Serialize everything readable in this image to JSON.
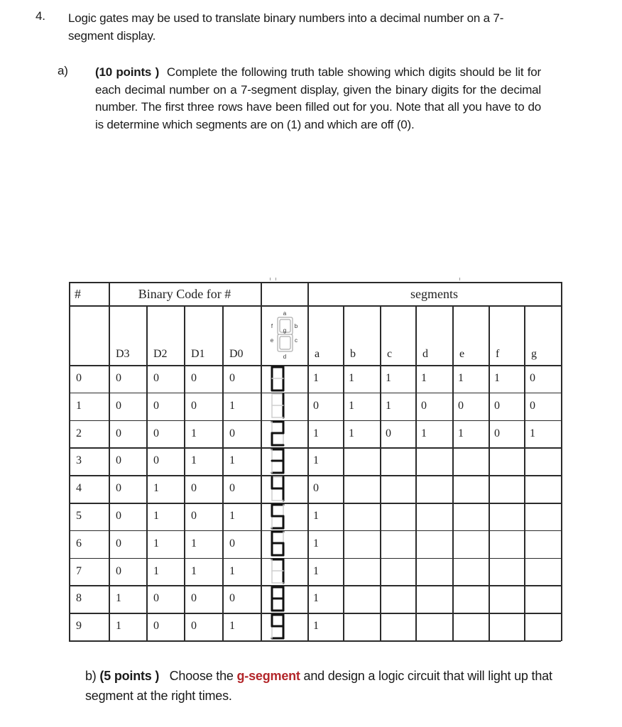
{
  "question": {
    "number": "4.",
    "text": "Logic gates may be used to translate binary numbers into a decimal number on a 7-segment display."
  },
  "part_a": {
    "label": "a)",
    "points": "(10 points )",
    "text": "Complete the following truth table showing which digits should be lit for each decimal number on a 7-segment display, given the binary digits for the decimal number. The first three rows have been filled out for you. Note that all you have to do is determine which segments are on (1) and which are off (0)."
  },
  "table": {
    "header_hash": "#",
    "header_binary": "Binary Code for #",
    "header_segments": "segments",
    "bit_headers": [
      "D3",
      "D2",
      "D1",
      "D0"
    ],
    "segment_headers": [
      "a",
      "b",
      "c",
      "d",
      "e",
      "f",
      "g"
    ],
    "diagram_labels": {
      "a": "a",
      "b": "b",
      "c": "c",
      "d": "d",
      "e": "e",
      "f": "f",
      "g": "g"
    },
    "rows": [
      {
        "num": "0",
        "bits": [
          "0",
          "0",
          "0",
          "0"
        ],
        "lit": "abcdef",
        "segs": [
          "1",
          "1",
          "1",
          "1",
          "1",
          "1",
          "0"
        ]
      },
      {
        "num": "1",
        "bits": [
          "0",
          "0",
          "0",
          "1"
        ],
        "lit": "bc",
        "segs": [
          "0",
          "1",
          "1",
          "0",
          "0",
          "0",
          "0"
        ]
      },
      {
        "num": "2",
        "bits": [
          "0",
          "0",
          "1",
          "0"
        ],
        "lit": "abdeg",
        "segs": [
          "1",
          "1",
          "0",
          "1",
          "1",
          "0",
          "1"
        ]
      },
      {
        "num": "3",
        "bits": [
          "0",
          "0",
          "1",
          "1"
        ],
        "lit": "abcdg",
        "segs": [
          "1",
          "",
          "",
          "",
          "",
          "",
          ""
        ]
      },
      {
        "num": "4",
        "bits": [
          "0",
          "1",
          "0",
          "0"
        ],
        "lit": "bcfg",
        "segs": [
          "0",
          "",
          "",
          "",
          "",
          "",
          ""
        ]
      },
      {
        "num": "5",
        "bits": [
          "0",
          "1",
          "0",
          "1"
        ],
        "lit": "acdfg",
        "segs": [
          "1",
          "",
          "",
          "",
          "",
          "",
          ""
        ]
      },
      {
        "num": "6",
        "bits": [
          "0",
          "1",
          "1",
          "0"
        ],
        "lit": "acdefg",
        "segs": [
          "1",
          "",
          "",
          "",
          "",
          "",
          ""
        ]
      },
      {
        "num": "7",
        "bits": [
          "0",
          "1",
          "1",
          "1"
        ],
        "lit": "abc",
        "segs": [
          "1",
          "",
          "",
          "",
          "",
          "",
          ""
        ]
      },
      {
        "num": "8",
        "bits": [
          "1",
          "0",
          "0",
          "0"
        ],
        "lit": "abcdefg",
        "segs": [
          "1",
          "",
          "",
          "",
          "",
          "",
          ""
        ]
      },
      {
        "num": "9",
        "bits": [
          "1",
          "0",
          "0",
          "1"
        ],
        "lit": "abcdfg",
        "segs": [
          "1",
          "",
          "",
          "",
          "",
          "",
          ""
        ]
      }
    ]
  },
  "part_b": {
    "label": "b)",
    "points": "(5 points )",
    "text_before": "Choose the",
    "highlight": "g-segment",
    "text_after": "and design a logic circuit that will light up that segment at the right times.",
    "highlight_color": "#b3262a"
  }
}
